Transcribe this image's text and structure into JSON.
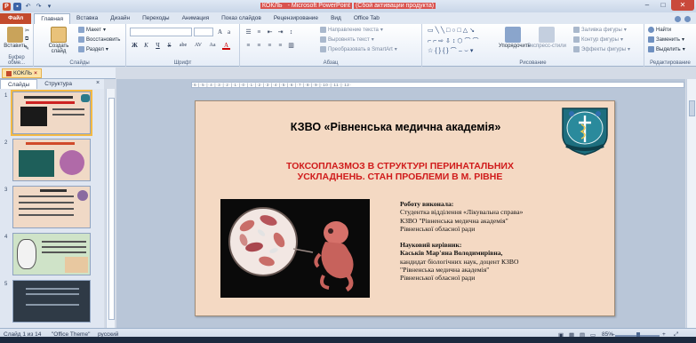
{
  "window": {
    "title_prefix": "КОКЛЬ",
    "title_app": " - Microsoft PowerPoint",
    "title_suffix": "(Сбой активации продукта)"
  },
  "ribbon_tabs": [
    "Файл",
    "Главная",
    "Вставка",
    "Дизайн",
    "Переходы",
    "Анимация",
    "Показ слайдов",
    "Рецензирование",
    "Вид",
    "Office Tab"
  ],
  "ribbon": {
    "clipboard": {
      "paste": "Вставить",
      "label": "Буфер обме..."
    },
    "slides": {
      "new_slide": "Создать слайд",
      "layout": "Макет",
      "reset": "Восстановить",
      "section": "Раздел",
      "label": "Слайды"
    },
    "font": {
      "label": "Шрифт",
      "bold": "Ж",
      "italic": "К",
      "underline": "Ч",
      "strike": "S",
      "shadow": "abe",
      "spacing": "AV",
      "case": "Aa",
      "color": "A"
    },
    "paragraph": {
      "label": "Абзац",
      "text_direction": "Направление текста",
      "align_text": "Выровнять текст",
      "smartart": "Преобразовать в SmartArt"
    },
    "drawing": {
      "arrange": "Упорядочить",
      "quick_styles": "Экспресс-стили",
      "fill": "Заливка фигуры",
      "outline": "Контур фигуры",
      "effects": "Эффекты фигуры",
      "label": "Рисование"
    },
    "editing": {
      "find": "Найти",
      "replace": "Заменить",
      "select": "Выделить",
      "label": "Редактирование"
    }
  },
  "doc_tab": {
    "name": "КОКЛЬ"
  },
  "left_pane": {
    "tabs": [
      "Слайды",
      "Структура"
    ],
    "slide_numbers": [
      "1",
      "2",
      "3",
      "4",
      "5"
    ]
  },
  "ruler_text": "·6·|·5·|·4·|·3·|·2·|·1·|·0·|·1·|·2·|·3·|·4·|·5·|·6·|·7·|·8·|·9·|·10·|·11·|·12·",
  "slide": {
    "title": "КЗВО «Рівненська медична академія»",
    "subtitle_line1": "ТОКСОПЛАЗМОЗ В СТРУКТУРІ ПЕРИНАТАЛЬНИХ",
    "subtitle_line2": "УСКЛАДНЕНЬ. СТАН ПРОБЛЕМИ В М. РІВНЕ",
    "author_heading": "Роботу виконала:",
    "author_line1": "Студентка відділення «Лікувальна справа»",
    "author_line2": "КЗВО \"Рівненська медична академія\"",
    "author_line3": "Рівненської обласної ради",
    "supervisor_heading": "Науковий керівник:",
    "supervisor_name": "Каськів Мар'яна Володимирівна,",
    "supervisor_line1": "кандидат біологічних наук, доцент КЗВО",
    "supervisor_line2": "\"Рівненська медична академія\"",
    "supervisor_line3": "Рівненської обласної ради"
  },
  "statusbar": {
    "slide_info": "Слайд 1 из 14",
    "theme": "\"Office Theme\"",
    "language": "русский",
    "zoom": "85%"
  },
  "colors": {
    "file_tab": "#c34a2c",
    "slide_bg": "#f4d9c3",
    "subtitle_red": "#d01c1c"
  }
}
